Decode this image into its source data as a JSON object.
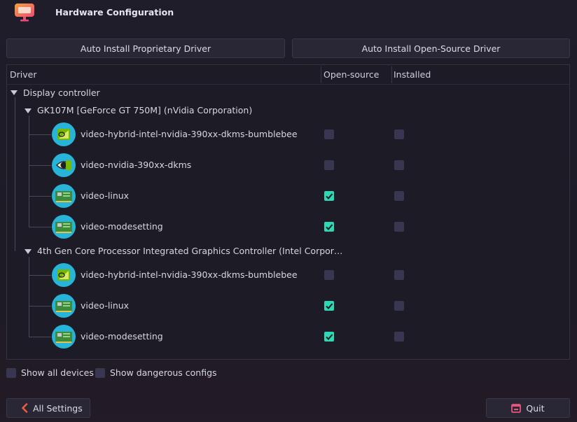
{
  "window": {
    "title": "Hardware Configuration"
  },
  "actions": {
    "proprietary_label": "Auto Install Proprietary Driver",
    "opensource_label": "Auto Install Open-Source Driver"
  },
  "table": {
    "columns": {
      "driver": "Driver",
      "opensource": "Open-source",
      "installed": "Installed"
    },
    "category": "Display controller",
    "devices": [
      {
        "name": "GK107M [GeForce GT 750M] (nVidia Corporation)",
        "drivers": [
          {
            "name": "video-hybrid-intel-nvidia-390xx-dkms-bumblebee",
            "icon": "nvidia-hybrid-icon",
            "open_source": false,
            "installed": false
          },
          {
            "name": "video-nvidia-390xx-dkms",
            "icon": "nvidia-icon",
            "open_source": false,
            "installed": false
          },
          {
            "name": "video-linux",
            "icon": "gpu-card-icon",
            "open_source": true,
            "installed": false
          },
          {
            "name": "video-modesetting",
            "icon": "gpu-card-icon",
            "open_source": true,
            "installed": false
          }
        ]
      },
      {
        "name": "4th Gen Core Processor Integrated Graphics Controller (Intel Corpor…",
        "drivers": [
          {
            "name": "video-hybrid-intel-nvidia-390xx-dkms-bumblebee",
            "icon": "nvidia-hybrid-icon",
            "open_source": false,
            "installed": false
          },
          {
            "name": "video-linux",
            "icon": "gpu-card-icon",
            "open_source": true,
            "installed": false
          },
          {
            "name": "video-modesetting",
            "icon": "gpu-card-icon",
            "open_source": true,
            "installed": false
          }
        ]
      }
    ]
  },
  "options": {
    "show_all_devices": {
      "label": "Show all devices",
      "checked": false
    },
    "show_dangerous": {
      "label": "Show dangerous configs",
      "checked": false
    }
  },
  "footer": {
    "all_settings": "All Settings",
    "quit": "Quit"
  },
  "colors": {
    "accent_check": "#2ed8b4",
    "icon_bg": "#27b4d8",
    "quit_accent": "#e8557a",
    "back_accent": "#f05a3c"
  }
}
